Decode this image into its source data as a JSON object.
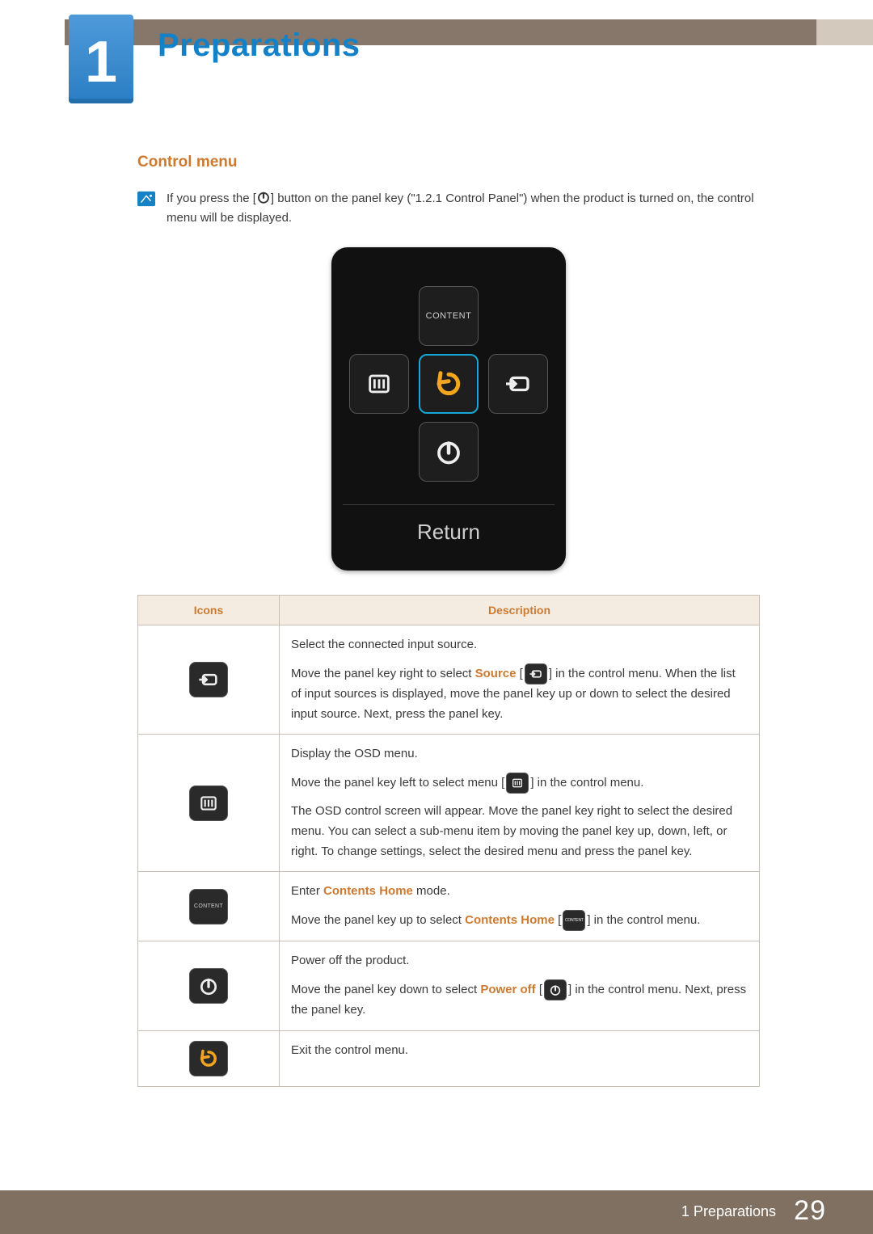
{
  "chapter": {
    "number": "1",
    "title": "Preparations"
  },
  "section": {
    "title": "Control menu"
  },
  "intro": {
    "pre": "If you press the [",
    "post": "] button on the panel key (\"1.2.1    Control Panel\") when the product is turned on, the control menu will be displayed."
  },
  "panel_illustration": {
    "content_label": "CONTENT",
    "return_label": "Return"
  },
  "table": {
    "headers": {
      "icons": "Icons",
      "description": "Description"
    },
    "row_source": {
      "line1": "Select the connected input source.",
      "line2_a": "Move the panel key right to select ",
      "source_word": "Source",
      "line2_b": " [",
      "line2_c": "] in the control menu. When the list of input sources is displayed, move the panel key up or down to select the desired input source. Next, press the panel key."
    },
    "row_menu": {
      "line1": "Display the OSD menu.",
      "line2_a": "Move the panel key left to select menu [",
      "line2_b": "] in the control menu.",
      "line3": "The OSD control screen will appear. Move the panel key right to select the desired menu. You can select a sub-menu item by moving the panel key up, down, left, or right. To change settings, select the desired menu and press the panel key."
    },
    "row_content": {
      "line1_a": "Enter ",
      "line1_b": "Contents Home",
      "line1_c": " mode.",
      "line2_a": "Move the panel key up to select ",
      "line2_b": "Contents Home",
      "line2_c": " [",
      "line2_d": "] in the control menu."
    },
    "row_power": {
      "line1": "Power off the product.",
      "line2_a": "Move the panel key down to select ",
      "power_word": "Power off",
      "line2_b": " [",
      "line2_c": "] in the control menu. Next, press the panel key."
    },
    "row_return": {
      "line1": "Exit the control menu."
    }
  },
  "footer": {
    "label": "1 Preparations",
    "page": "29"
  },
  "icons": {
    "content_btn_label": "CONTENT",
    "mini_content_label": "CONTENT"
  }
}
